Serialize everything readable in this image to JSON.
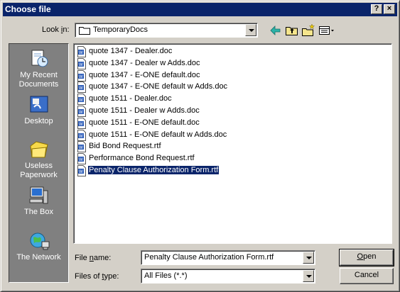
{
  "window": {
    "title": "Choose file",
    "help_button": "?",
    "close_button": "×"
  },
  "look_in": {
    "label_pre": "Look ",
    "label_u": "i",
    "label_post": "n:",
    "value": "TemporaryDocs"
  },
  "toolbar": {
    "back_icon": "back-arrow-icon",
    "up_icon": "up-folder-icon",
    "new_folder_icon": "new-folder-icon",
    "view_icon": "view-menu-icon"
  },
  "places": [
    {
      "label1": "My Recent",
      "label2": "Documents",
      "icon": "recent-documents-icon"
    },
    {
      "label1": "Desktop",
      "label2": "",
      "icon": "desktop-icon"
    },
    {
      "label1": "Useless",
      "label2": "Paperwork",
      "icon": "folder-icon"
    },
    {
      "label1": "The Box",
      "label2": "",
      "icon": "computer-icon"
    },
    {
      "label1": "The Network",
      "label2": "",
      "icon": "network-icon"
    }
  ],
  "files": [
    {
      "name": "quote 1347 - Dealer.doc",
      "selected": false
    },
    {
      "name": "quote 1347 - Dealer w Adds.doc",
      "selected": false
    },
    {
      "name": "quote 1347 - E-ONE default.doc",
      "selected": false
    },
    {
      "name": "quote 1347 - E-ONE default w Adds.doc",
      "selected": false
    },
    {
      "name": "quote 1511 - Dealer.doc",
      "selected": false
    },
    {
      "name": "quote 1511 - Dealer w Adds.doc",
      "selected": false
    },
    {
      "name": "quote 1511 - E-ONE default.doc",
      "selected": false
    },
    {
      "name": "quote 1511 - E-ONE default w Adds.doc",
      "selected": false
    },
    {
      "name": "Bid Bond Request.rtf",
      "selected": false
    },
    {
      "name": "Performance Bond Request.rtf",
      "selected": false
    },
    {
      "name": "Penalty Clause Authorization Form.rtf",
      "selected": true
    }
  ],
  "file_name": {
    "label_pre": "File ",
    "label_u": "n",
    "label_post": "ame:",
    "value": "Penalty Clause Authorization Form.rtf"
  },
  "file_type": {
    "label_pre": "Files of ",
    "label_u": "t",
    "label_post": "ype:",
    "value": "All Files (*.*)"
  },
  "buttons": {
    "open_u": "O",
    "open_rest": "pen",
    "cancel": "Cancel"
  },
  "colors": {
    "titlebar": "#0a246a",
    "selection": "#0a246a",
    "face": "#d4d0c8",
    "places_bg": "#808080"
  }
}
